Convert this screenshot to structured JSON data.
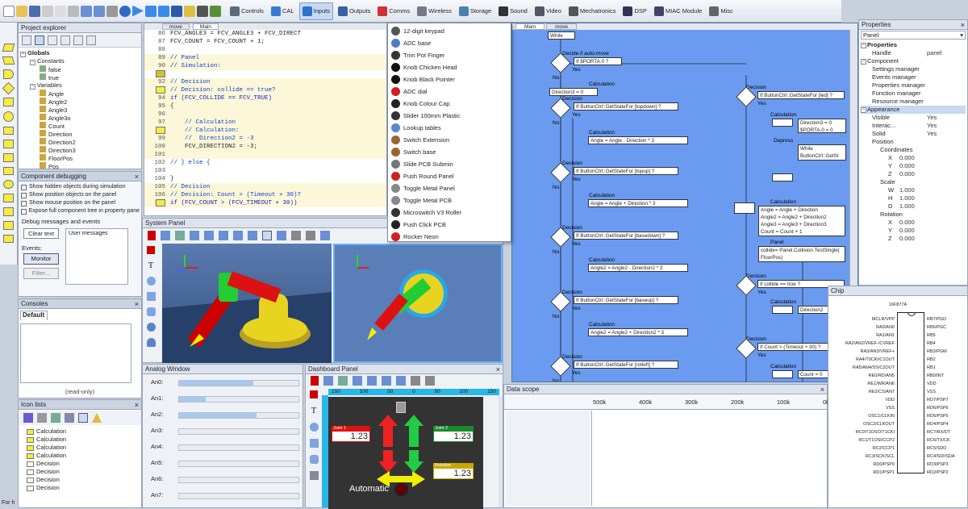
{
  "toolbar": {
    "menus": [
      {
        "label": "Controls",
        "color": "#5a6b7d"
      },
      {
        "label": "CAL",
        "color": "#3a7bd5"
      },
      {
        "label": "Inputs",
        "color": "#2b73c9"
      },
      {
        "label": "Outputs",
        "color": "#3b5fa3"
      },
      {
        "label": "Comms",
        "color": "#c33"
      },
      {
        "label": "Wireless",
        "color": "#778"
      },
      {
        "label": "Storage",
        "color": "#4b7fb0"
      },
      {
        "label": "Sound",
        "color": "#333"
      },
      {
        "label": "Video",
        "color": "#556"
      },
      {
        "label": "Mechatronics",
        "color": "#555"
      },
      {
        "label": "DSP",
        "color": "#335"
      },
      {
        "label": "MIAC Module",
        "color": "#446"
      },
      {
        "label": "Misc",
        "color": "#666"
      }
    ]
  },
  "project_explorer": {
    "title": "Project explorer",
    "tree": [
      {
        "label": "Globals",
        "level": 0,
        "bold": true
      },
      {
        "label": "Constants",
        "level": 1
      },
      {
        "label": "false",
        "level": 2
      },
      {
        "label": "true",
        "level": 2
      },
      {
        "label": "Variables",
        "level": 1
      },
      {
        "label": "Angle",
        "level": 2
      },
      {
        "label": "Angle2",
        "level": 2
      },
      {
        "label": "Angle3",
        "level": 2
      },
      {
        "label": "Angle3o",
        "level": 2
      },
      {
        "label": "Count",
        "level": 2
      },
      {
        "label": "Direction",
        "level": 2
      },
      {
        "label": "Direction2",
        "level": 2
      },
      {
        "label": "Direction3",
        "level": 2
      },
      {
        "label": "FloorPos",
        "level": 2
      },
      {
        "label": "Pos",
        "level": 2
      }
    ]
  },
  "component_debugging": {
    "title": "Component debugging",
    "options": [
      "Show hidden objects during simulation",
      "Show position objects on the panel",
      "Show mouse position on the panel",
      "Expose full component tree in property pane"
    ],
    "debug_label": "Debug messages and events",
    "clear_text": "Clear text",
    "user_messages": "User messages",
    "events_label": "Events:",
    "monitor": "Monitor",
    "filter": "Filter..."
  },
  "consoles": {
    "title": "Consoles",
    "tab": "Default",
    "footer": "(read-only)"
  },
  "icon_lists": {
    "title": "Icon lists",
    "items": [
      "Calculation",
      "Calculation",
      "Calculation",
      "Calculation",
      "Decision",
      "Decision",
      "Decision",
      "Decision"
    ]
  },
  "code": {
    "tabs": [
      "move",
      "Main"
    ],
    "lines": [
      {
        "n": "86",
        "text": "FCV_ANGLE3 = FCV_ANGLE3 + FCV_DIRECT",
        "type": "code"
      },
      {
        "n": "87",
        "text": "FCV_COUNT = FCV_COUNT + 1;",
        "type": "code"
      },
      {
        "n": "88",
        "text": "",
        "type": "code"
      },
      {
        "n": "89",
        "text": "// Panel",
        "type": "comment"
      },
      {
        "n": "90",
        "text": "// Simulation:",
        "type": "comment"
      },
      {
        "n": "91",
        "text": "",
        "type": "code"
      },
      {
        "n": "92",
        "text": "// Decision",
        "type": "comment"
      },
      {
        "n": "93",
        "text": "// Decision: collide == true?",
        "type": "comment"
      },
      {
        "n": "94",
        "text": "if (FCV_COLLIDE == FCV_TRUE)",
        "type": "kw"
      },
      {
        "n": "95",
        "text": "{",
        "type": "code"
      },
      {
        "n": "96",
        "text": "",
        "type": "code"
      },
      {
        "n": "97",
        "text": "    // Calculation",
        "type": "comment"
      },
      {
        "n": "98",
        "text": "    // Calculation:",
        "type": "comment"
      },
      {
        "n": "99",
        "text": "    //  Direction2 = -3",
        "type": "comment"
      },
      {
        "n": "100",
        "text": "    FCV_DIRECTION2 = -3;",
        "type": "code"
      },
      {
        "n": "101",
        "text": "",
        "type": "code"
      },
      {
        "n": "102",
        "text": "// } else {",
        "type": "comment"
      },
      {
        "n": "103",
        "text": "",
        "type": "code"
      },
      {
        "n": "104",
        "text": "}",
        "type": "code"
      },
      {
        "n": "105",
        "text": "// Decision",
        "type": "comment"
      },
      {
        "n": "106",
        "text": "// Decision: Count > (Timeout + 30)?",
        "type": "comment"
      },
      {
        "n": "107",
        "text": "if (FCV_COUNT > (FCV_TIMEOUT + 30))",
        "type": "kw"
      }
    ]
  },
  "inputs_menu": {
    "items": [
      {
        "label": "12-digit keypad",
        "color": "#555"
      },
      {
        "label": "ADC base",
        "color": "#4a7fbf"
      },
      {
        "label": "Trim Pot Finger",
        "color": "#333"
      },
      {
        "label": "Knob Chicken Head",
        "color": "#111"
      },
      {
        "label": "Knob Black Pointer",
        "color": "#111"
      },
      {
        "label": "ADC dial",
        "color": "#c22"
      },
      {
        "label": "Knob Colour Cap",
        "color": "#222"
      },
      {
        "label": "Slider 100mm Plastic",
        "color": "#333"
      },
      {
        "label": "Lookup tables",
        "color": "#5588cc"
      },
      {
        "label": "Switch Extension",
        "color": "#996633"
      },
      {
        "label": "Switch base",
        "color": "#996633"
      },
      {
        "label": "Slide PCB Submin",
        "color": "#777"
      },
      {
        "label": "Push Round Panel",
        "color": "#c22"
      },
      {
        "label": "Toggle Metal Panel",
        "color": "#888"
      },
      {
        "label": "Toggle Metal PCB",
        "color": "#888"
      },
      {
        "label": "Microswitch V3 Roller",
        "color": "#333"
      },
      {
        "label": "Push Click PCB",
        "color": "#222"
      },
      {
        "label": "Rocker Neon",
        "color": "#c22"
      }
    ]
  },
  "flowchart": {
    "tabs": [
      "Main",
      "move"
    ],
    "start": "While",
    "left_labels": [
      {
        "title": "Decide if auto-move",
        "box": "If $PORTA.0 ?"
      },
      {
        "title": "Calculation",
        "box": "Direction3 = 0"
      },
      {
        "title": "Decision",
        "box": "If ButtonCtrl::GetStateFor [topdown] ?"
      },
      {
        "title": "Calculation",
        "box": "Angle = Angle - Direction * 3"
      },
      {
        "title": "Decision",
        "box": "If ButtonCtrl::GetStateFor [topup] ?"
      },
      {
        "title": "Calculation",
        "box": "Angle = Angle + Direction * 3"
      },
      {
        "title": "Decision",
        "box": "If ButtonCtrl::GetStateFor [basedown] ?"
      },
      {
        "title": "Calculation",
        "box": "Angle2 = Angle2 - Direction2 * 3"
      },
      {
        "title": "Decision",
        "box": "If ButtonCtrl::GetStateFor [baseup] ?"
      },
      {
        "title": "Calculation",
        "box": "Angle2 = Angle2 + Direction2 * 3"
      },
      {
        "title": "Decision",
        "box": "If ButtonCtrl::GetStateFor [rotleft] ?"
      }
    ],
    "right_labels": [
      {
        "title": "Decision",
        "box": "If ButtonCtrl::GetStateFor [led] ?"
      },
      {
        "title": "Calculation",
        "box": "Direction3 = 0\n$PORTA.0 = 0"
      },
      {
        "title": "Depress",
        "box": "While\nButtonCtrl::GetSt"
      },
      {
        "title": "Calculation",
        "box": "Angle = Angle + Direction\nAngle2 = Angle2 + Direction2\nAngle3 = Angle3 + Direction3\nCount = Count + 1"
      },
      {
        "title": "Panel",
        "box": "collide= Panel.Collision.TestSingle(\nFloorPos)"
      },
      {
        "title": "Decision",
        "box": "If collide == true ?"
      },
      {
        "title": "Calculation",
        "box": "Direction2"
      },
      {
        "title": "Decision",
        "box": "If Count > (Timeout + 30) ?"
      },
      {
        "title": "Calculation",
        "box": "Count = 0"
      }
    ],
    "yes": "Yes",
    "no": "No"
  },
  "properties": {
    "title": "Properties",
    "selected": "Panel",
    "rows": [
      {
        "label": "Properties",
        "value": "",
        "level": 0,
        "bold": true
      },
      {
        "label": "Handle",
        "value": "panel",
        "level": 1
      },
      {
        "label": "Component",
        "value": "",
        "level": 0
      },
      {
        "label": "Settings manager",
        "value": "",
        "level": 1
      },
      {
        "label": "Events manager",
        "value": "",
        "level": 1
      },
      {
        "label": "Properties manager",
        "value": "",
        "level": 1
      },
      {
        "label": "Function manager",
        "value": "",
        "level": 1
      },
      {
        "label": "Resource manager",
        "value": "",
        "level": 1
      },
      {
        "label": "Appearance",
        "value": "",
        "level": 0,
        "highlight": true
      },
      {
        "label": "Visible",
        "value": "Yes",
        "level": 1
      },
      {
        "label": "Interac...",
        "value": "Yes",
        "level": 1
      },
      {
        "label": "Solid",
        "value": "Yes",
        "level": 1
      },
      {
        "label": "Position",
        "value": "",
        "level": 1
      },
      {
        "label": "Coordinates",
        "value": "",
        "level": 2
      },
      {
        "label": "X",
        "value": "0.000",
        "level": 3
      },
      {
        "label": "Y",
        "value": "0.000",
        "level": 3
      },
      {
        "label": "Z",
        "value": "0.000",
        "level": 3
      },
      {
        "label": "Scale",
        "value": "",
        "level": 2
      },
      {
        "label": "W",
        "value": "1.000",
        "level": 3
      },
      {
        "label": "H",
        "value": "1.000",
        "level": 3
      },
      {
        "label": "D",
        "value": "1.000",
        "level": 3
      },
      {
        "label": "Rotation",
        "value": "",
        "level": 2
      },
      {
        "label": "X",
        "value": "0.000",
        "level": 3
      },
      {
        "label": "Y",
        "value": "0.000",
        "level": 3
      },
      {
        "label": "Z",
        "value": "0.000",
        "level": 3
      }
    ]
  },
  "system_panel": {
    "title": "System Panel"
  },
  "analog_window": {
    "title": "Analog Window",
    "rows": [
      {
        "label": "An0:",
        "fill": 0.62
      },
      {
        "label": "An1:",
        "fill": 0.22
      },
      {
        "label": "An2:",
        "fill": 0.65
      },
      {
        "label": "An3:",
        "fill": 0
      },
      {
        "label": "An4:",
        "fill": 0
      },
      {
        "label": "An5:",
        "fill": 0
      },
      {
        "label": "An6:",
        "fill": 0
      },
      {
        "label": "An7:",
        "fill": 0
      }
    ]
  },
  "dashboard": {
    "title": "Dashboard Panel",
    "ruler": [
      "150",
      "100",
      "50",
      "0",
      "50",
      "100",
      "150"
    ],
    "joint1_label": "Joint 1",
    "joint1_value": "1.23",
    "joint2_label": "Joint 2",
    "joint2_value": "1.23",
    "rotation_label": "Rotation",
    "rotation_value": "1.23",
    "mode": "Automatic"
  },
  "data_scope": {
    "title": "Data scope",
    "ticks": [
      "500k",
      "400k",
      "300k",
      "200k",
      "100k",
      "0k"
    ]
  },
  "chip": {
    "title": "Chip",
    "part": "16F877A",
    "left_pins": [
      "MCLR/VPP",
      "RA0/AN0",
      "RA1/AN1",
      "RA2/AN2/VREF-/CVREF",
      "RA3/AN3/VREF+",
      "RA4/T0CKI/C1OUT",
      "RA5/AN4/SS/C2OUT",
      "RE0/RD/AN5",
      "RE1/WR/AN6",
      "RE2/CS/AN7",
      "VDD",
      "VSS",
      "OSC1/CLKIN",
      "OSC2/CLKOUT",
      "RC0/T1OSO/T1CKI",
      "RC1/T1OSI/CCP2",
      "RC2/CCP1",
      "RC3/SCK/SCL",
      "RD0/PSP0",
      "RD1/PSP1"
    ],
    "right_pins": [
      "RB7/PGD",
      "RB6/PGC",
      "RB5",
      "RB4",
      "RB3/PGM",
      "RB2",
      "RB1",
      "RB0/INT",
      "VDD",
      "VSS",
      "RD7/PSP7",
      "RD6/PSP6",
      "RD5/PSP5",
      "RD4/PSP4",
      "RC7/RX/DT",
      "RC6/TX/CK",
      "RC5/SDO",
      "RC4/SDI/SDA",
      "RD3/PSP3",
      "RD2/PSP2"
    ]
  },
  "status": "For h"
}
